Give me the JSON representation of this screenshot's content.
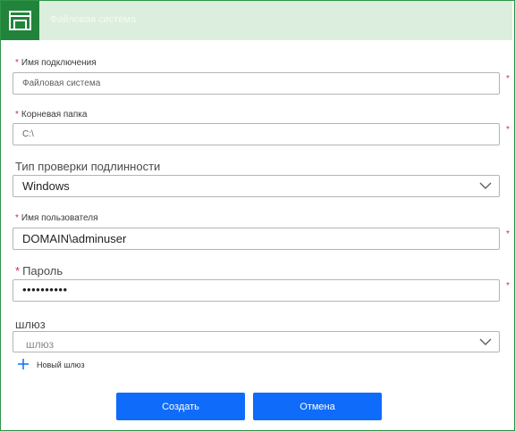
{
  "header": {
    "title": "Файловая система",
    "icon": "folder-window-icon",
    "accent": "#21843a",
    "band_color": "#dceede"
  },
  "form": {
    "connection_name": {
      "label": "Имя подключения",
      "value": "Файловая система",
      "required": true
    },
    "root_folder": {
      "label": "Корневая папка",
      "value": "C:\\",
      "required": true
    },
    "auth_type": {
      "label": "Тип проверки подлинности",
      "value": "Windows"
    },
    "username": {
      "label": "Имя пользователя",
      "value": "DOMAIN\\adminuser",
      "required": true
    },
    "password": {
      "label": "Пароль",
      "value": "••••••••••",
      "required": true
    },
    "gateway": {
      "label": "шлюз",
      "placeholder": "шлюз",
      "add_label": "Новый шлюз"
    },
    "required_mark": "*"
  },
  "buttons": {
    "create": "Создать",
    "cancel": "Отмена",
    "color": "#0f6cfb"
  }
}
